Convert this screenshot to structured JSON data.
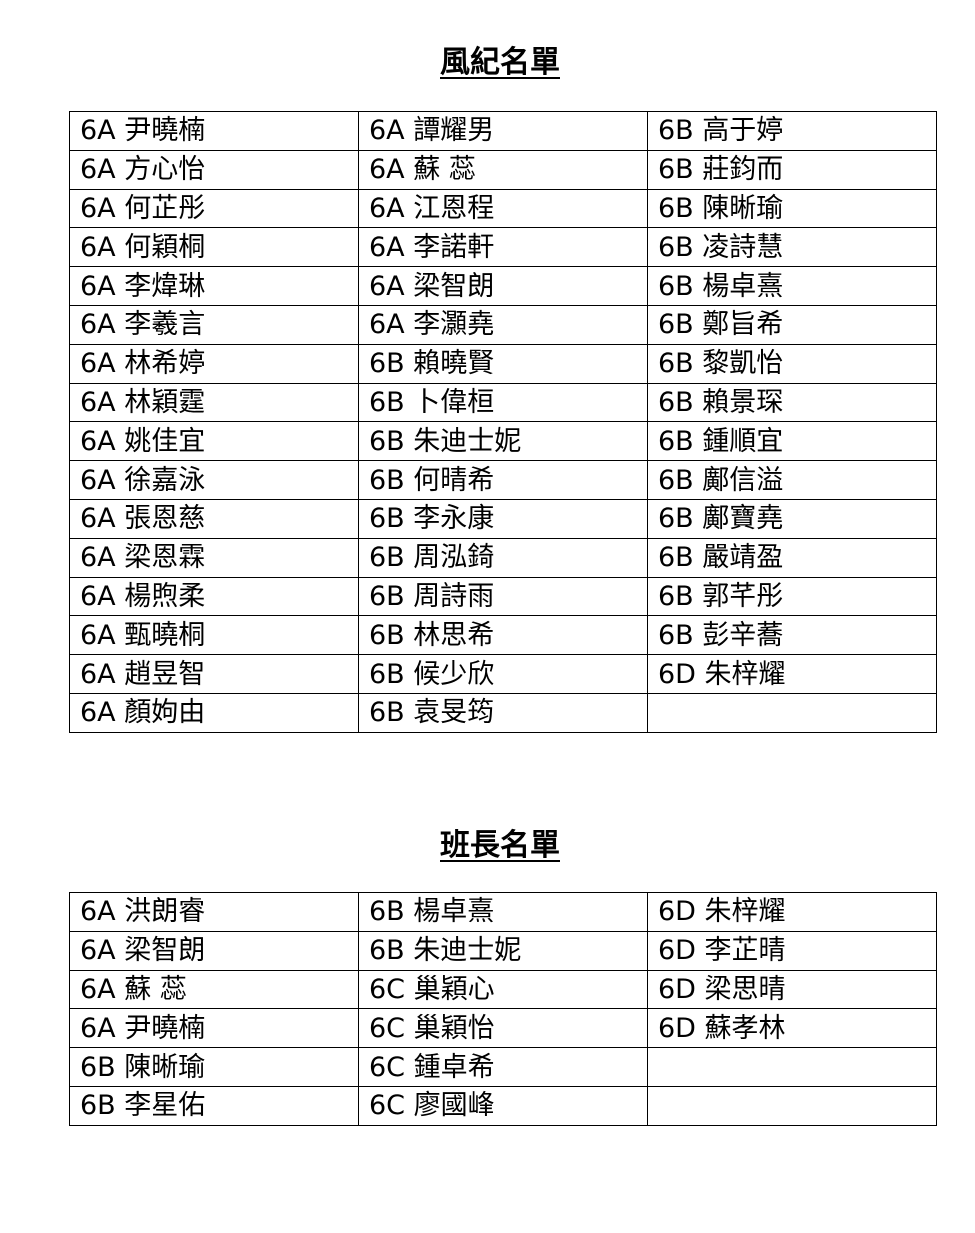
{
  "prefects": {
    "title": "風紀名單",
    "rows": [
      [
        "6A 尹曉楠",
        "6A 譚耀男",
        "6B 高于婷"
      ],
      [
        "6A 方心怡",
        "6A 蘇 蕊",
        "6B 莊鈞而"
      ],
      [
        "6A 何芷彤",
        "6A 江恩程",
        "6B 陳晰瑜"
      ],
      [
        "6A 何穎桐",
        "6A 李諾軒",
        "6B 凌詩慧"
      ],
      [
        "6A 李煒琳",
        "6A 梁智朗",
        "6B 楊卓熹"
      ],
      [
        "6A 李羲言",
        "6A 李灝堯",
        "6B 鄭旨希"
      ],
      [
        "6A 林希婷",
        "6B 賴曉賢",
        "6B 黎凱怡"
      ],
      [
        "6A 林穎霆",
        "6B 卜偉桓",
        "6B 賴景琛"
      ],
      [
        "6A 姚佳宜",
        "6B 朱迪士妮",
        "6B 鍾順宜"
      ],
      [
        "6A 徐嘉泳",
        "6B 何晴希",
        "6B 鄺信溢"
      ],
      [
        "6A 張恩慈",
        "6B 李永康",
        "6B 鄺寶堯"
      ],
      [
        "6A 梁恩霖",
        "6B 周泓錡",
        "6B 嚴靖盈"
      ],
      [
        "6A 楊煦柔",
        "6B 周詩雨",
        "6B 郭芊彤"
      ],
      [
        "6A 甄曉桐",
        "6B 林思希",
        "6B 彭辛蕎"
      ],
      [
        "6A 趙昱智",
        "6B 候少欣",
        "6D 朱梓耀"
      ],
      [
        "6A 顏姁由",
        "6B 袁旻筠",
        ""
      ]
    ]
  },
  "monitors": {
    "title": "班長名單",
    "rows": [
      [
        "6A 洪朗睿",
        "6B 楊卓熹",
        "6D 朱梓耀"
      ],
      [
        "6A 梁智朗",
        "6B 朱迪士妮",
        "6D 李芷晴"
      ],
      [
        "6A 蘇 蕊",
        "6C 巢穎心",
        "6D 梁思晴"
      ],
      [
        "6A 尹曉楠",
        "6C 巢穎怡",
        "6D 蘇孝林"
      ],
      [
        "6B 陳晰瑜",
        "6C 鍾卓希",
        ""
      ],
      [
        "6B 李星佑",
        "6C 廖國峰",
        ""
      ]
    ]
  }
}
